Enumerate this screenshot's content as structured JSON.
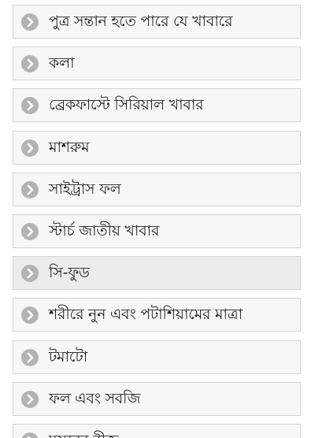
{
  "list": {
    "items": [
      {
        "label": "পুত্র সন্তান হতে পারে যে খাবারে",
        "icon": "chevron-right-circle-icon"
      },
      {
        "label": "কলা",
        "icon": "chevron-right-circle-icon"
      },
      {
        "label": "ব্রেকফাস্টে সিরিয়াল খাবার",
        "icon": "chevron-right-circle-icon"
      },
      {
        "label": "মাশরুম",
        "icon": "chevron-right-circle-icon"
      },
      {
        "label": "সাইট্রাস ফল",
        "icon": "chevron-right-circle-icon"
      },
      {
        "label": "স্টার্চ জাতীয় খাবার",
        "icon": "chevron-right-circle-icon"
      },
      {
        "label": "সি-ফুড",
        "icon": "chevron-right-circle-icon",
        "highlighted": true
      },
      {
        "label": "শরীরে নুন এবং পটাশিয়ামের মাত্রা",
        "icon": "chevron-right-circle-icon"
      },
      {
        "label": "টমাটো",
        "icon": "chevron-right-circle-icon"
      },
      {
        "label": "ফল এবং সবজি",
        "icon": "chevron-right-circle-icon"
      },
      {
        "label": "মসুরের বীজ",
        "icon": "chevron-right-circle-icon"
      }
    ]
  },
  "colors": {
    "item_background": "#f7f7f7",
    "item_highlight_background": "#ececec",
    "item_border": "#d4d4d4",
    "icon_circle": "#b3b3b3",
    "icon_chevron": "#ffffff",
    "text": "#222222"
  }
}
